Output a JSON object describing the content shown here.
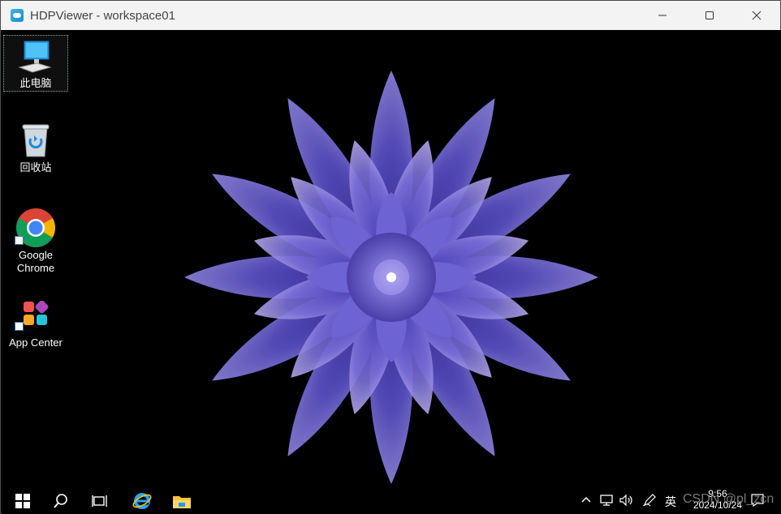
{
  "window": {
    "title": "HDPViewer - workspace01"
  },
  "desktop": {
    "icons": [
      {
        "label": "此电脑",
        "icon": "computer-icon"
      },
      {
        "label": "回收站",
        "icon": "recycle-bin-icon"
      },
      {
        "label": "Google\nChrome",
        "icon": "chrome-icon"
      },
      {
        "label": "App Center",
        "icon": "app-center-icon"
      }
    ]
  },
  "taskbar": {
    "items": [
      "start-icon",
      "search-icon",
      "task-view-icon",
      "internet-explorer-icon",
      "file-explorer-icon"
    ],
    "tray": {
      "ime": "英",
      "time": "9:56",
      "date": "2024/10/24"
    }
  },
  "watermark": "CSDN @pl_zcn",
  "colors": {
    "titlebar": "#f3f3f3",
    "desktop": "#000000",
    "flower": "#5a4fc8"
  }
}
